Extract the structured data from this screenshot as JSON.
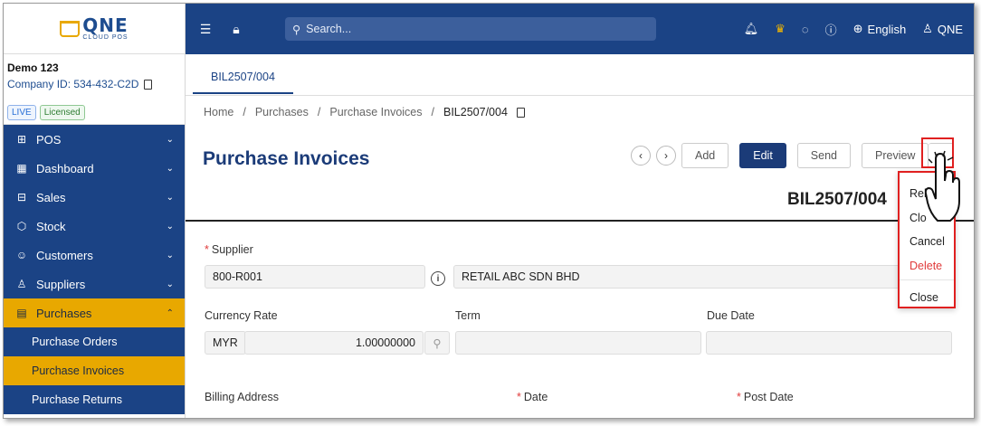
{
  "logo": {
    "brand": "QNE",
    "sub": "CLOUD POS"
  },
  "company": {
    "name": "Demo 123",
    "id_label": "Company ID: 534-432-C2D"
  },
  "badges": {
    "live": "LIVE",
    "licensed": "Licensed"
  },
  "sidebar": {
    "items": [
      {
        "label": "POS",
        "icon": "pos-icon"
      },
      {
        "label": "Dashboard",
        "icon": "dashboard-icon"
      },
      {
        "label": "Sales",
        "icon": "sales-icon"
      },
      {
        "label": "Stock",
        "icon": "stock-icon"
      },
      {
        "label": "Customers",
        "icon": "customers-icon"
      },
      {
        "label": "Suppliers",
        "icon": "suppliers-icon"
      },
      {
        "label": "Purchases",
        "icon": "purchases-icon"
      }
    ],
    "sub_items": [
      {
        "label": "Purchase Orders"
      },
      {
        "label": "Purchase Invoices"
      },
      {
        "label": "Purchase Returns"
      }
    ]
  },
  "topbar": {
    "search_placeholder": "Search...",
    "language": "English",
    "user": "QNE"
  },
  "tab": {
    "label": "BIL2507/004"
  },
  "breadcrumb": {
    "home": "Home",
    "purchases": "Purchases",
    "invoices": "Purchase Invoices",
    "current": "BIL2507/004"
  },
  "page": {
    "title": "Purchase Invoices",
    "doc_no": "BIL2507/004"
  },
  "actions": {
    "add": "Add",
    "edit": "Edit",
    "send": "Send",
    "preview": "Preview"
  },
  "dropdown": {
    "reload": "Relo",
    "clone": "Clo",
    "cancel": "Cancel",
    "delete": "Delete",
    "close": "Close"
  },
  "form": {
    "supplier_label": "Supplier",
    "supplier_code": "800-R001",
    "supplier_name": "RETAIL ABC SDN BHD",
    "currency_rate_label": "Currency Rate",
    "currency": "MYR",
    "rate": "1.00000000",
    "term_label": "Term",
    "due_date_label": "Due Date",
    "billing_address_label": "Billing Address",
    "date_label": "Date",
    "post_date_label": "Post Date"
  },
  "colors": {
    "primary": "#1b4385",
    "accent": "#e8a800",
    "highlight": "#e02020"
  }
}
